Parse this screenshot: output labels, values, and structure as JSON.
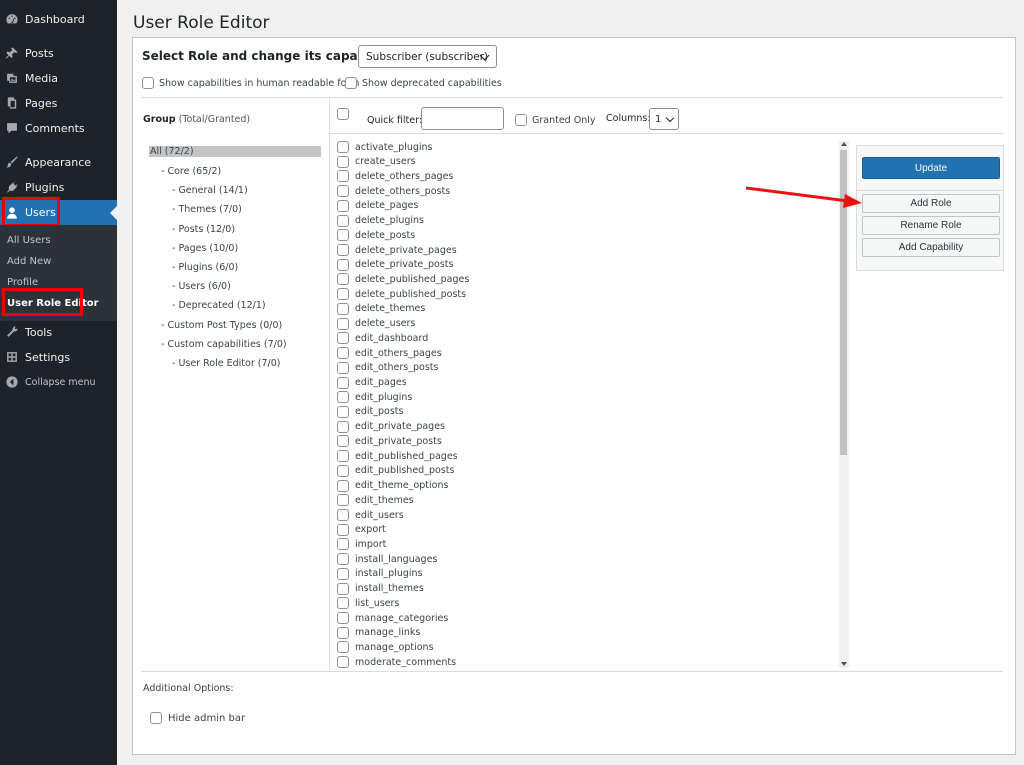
{
  "sidebar": {
    "items": [
      {
        "label": "Dashboard",
        "icon": "dashboard-icon"
      },
      {
        "label": "Posts",
        "icon": "pin-icon"
      },
      {
        "label": "Media",
        "icon": "media-icon"
      },
      {
        "label": "Pages",
        "icon": "pages-icon"
      },
      {
        "label": "Comments",
        "icon": "comment-icon"
      },
      {
        "label": "Appearance",
        "icon": "brush-icon"
      },
      {
        "label": "Plugins",
        "icon": "plug-icon"
      },
      {
        "label": "Users",
        "icon": "user-icon"
      },
      {
        "label": "Tools",
        "icon": "wrench-icon"
      },
      {
        "label": "Settings",
        "icon": "settings-icon"
      },
      {
        "label": "Collapse menu",
        "icon": "collapse-icon"
      }
    ],
    "submenu": [
      "All Users",
      "Add New",
      "Profile",
      "User Role Editor"
    ],
    "accent": "#2271b1"
  },
  "page": {
    "title": "User Role Editor"
  },
  "role": {
    "label": "Select Role and change its capabilities:",
    "selected": "Subscriber (subscriber)"
  },
  "options": {
    "human_readable": "Show capabilities in human readable form",
    "deprecated": "Show deprecated capabilities"
  },
  "group_header": {
    "title": "Group",
    "sub": "(Total/Granted)"
  },
  "filter": {
    "quick_filter_label": "Quick filter:",
    "granted_only": "Granted Only",
    "columns_label": "Columns:",
    "columns_value": "1"
  },
  "tree": [
    "All (72/2)",
    "- Core (65/2)",
    "- General (14/1)",
    "- Themes (7/0)",
    "- Posts (12/0)",
    "- Pages (10/0)",
    "- Plugins (6/0)",
    "- Users (6/0)",
    "- Deprecated (12/1)",
    "- Custom Post Types (0/0)",
    "- Custom capabilities (7/0)",
    "- User Role Editor (7/0)"
  ],
  "capabilities": [
    "activate_plugins",
    "create_users",
    "delete_others_pages",
    "delete_others_posts",
    "delete_pages",
    "delete_plugins",
    "delete_posts",
    "delete_private_pages",
    "delete_private_posts",
    "delete_published_pages",
    "delete_published_posts",
    "delete_themes",
    "delete_users",
    "edit_dashboard",
    "edit_others_pages",
    "edit_others_posts",
    "edit_pages",
    "edit_plugins",
    "edit_posts",
    "edit_private_pages",
    "edit_private_posts",
    "edit_published_pages",
    "edit_published_posts",
    "edit_theme_options",
    "edit_themes",
    "edit_users",
    "export",
    "import",
    "install_languages",
    "install_plugins",
    "install_themes",
    "list_users",
    "manage_categories",
    "manage_links",
    "manage_options",
    "moderate_comments"
  ],
  "actions": {
    "update": "Update",
    "add_role": "Add Role",
    "rename_role": "Rename Role",
    "add_capability": "Add Capability"
  },
  "additional": {
    "label": "Additional Options:",
    "hide_admin_bar": "Hide admin bar"
  }
}
